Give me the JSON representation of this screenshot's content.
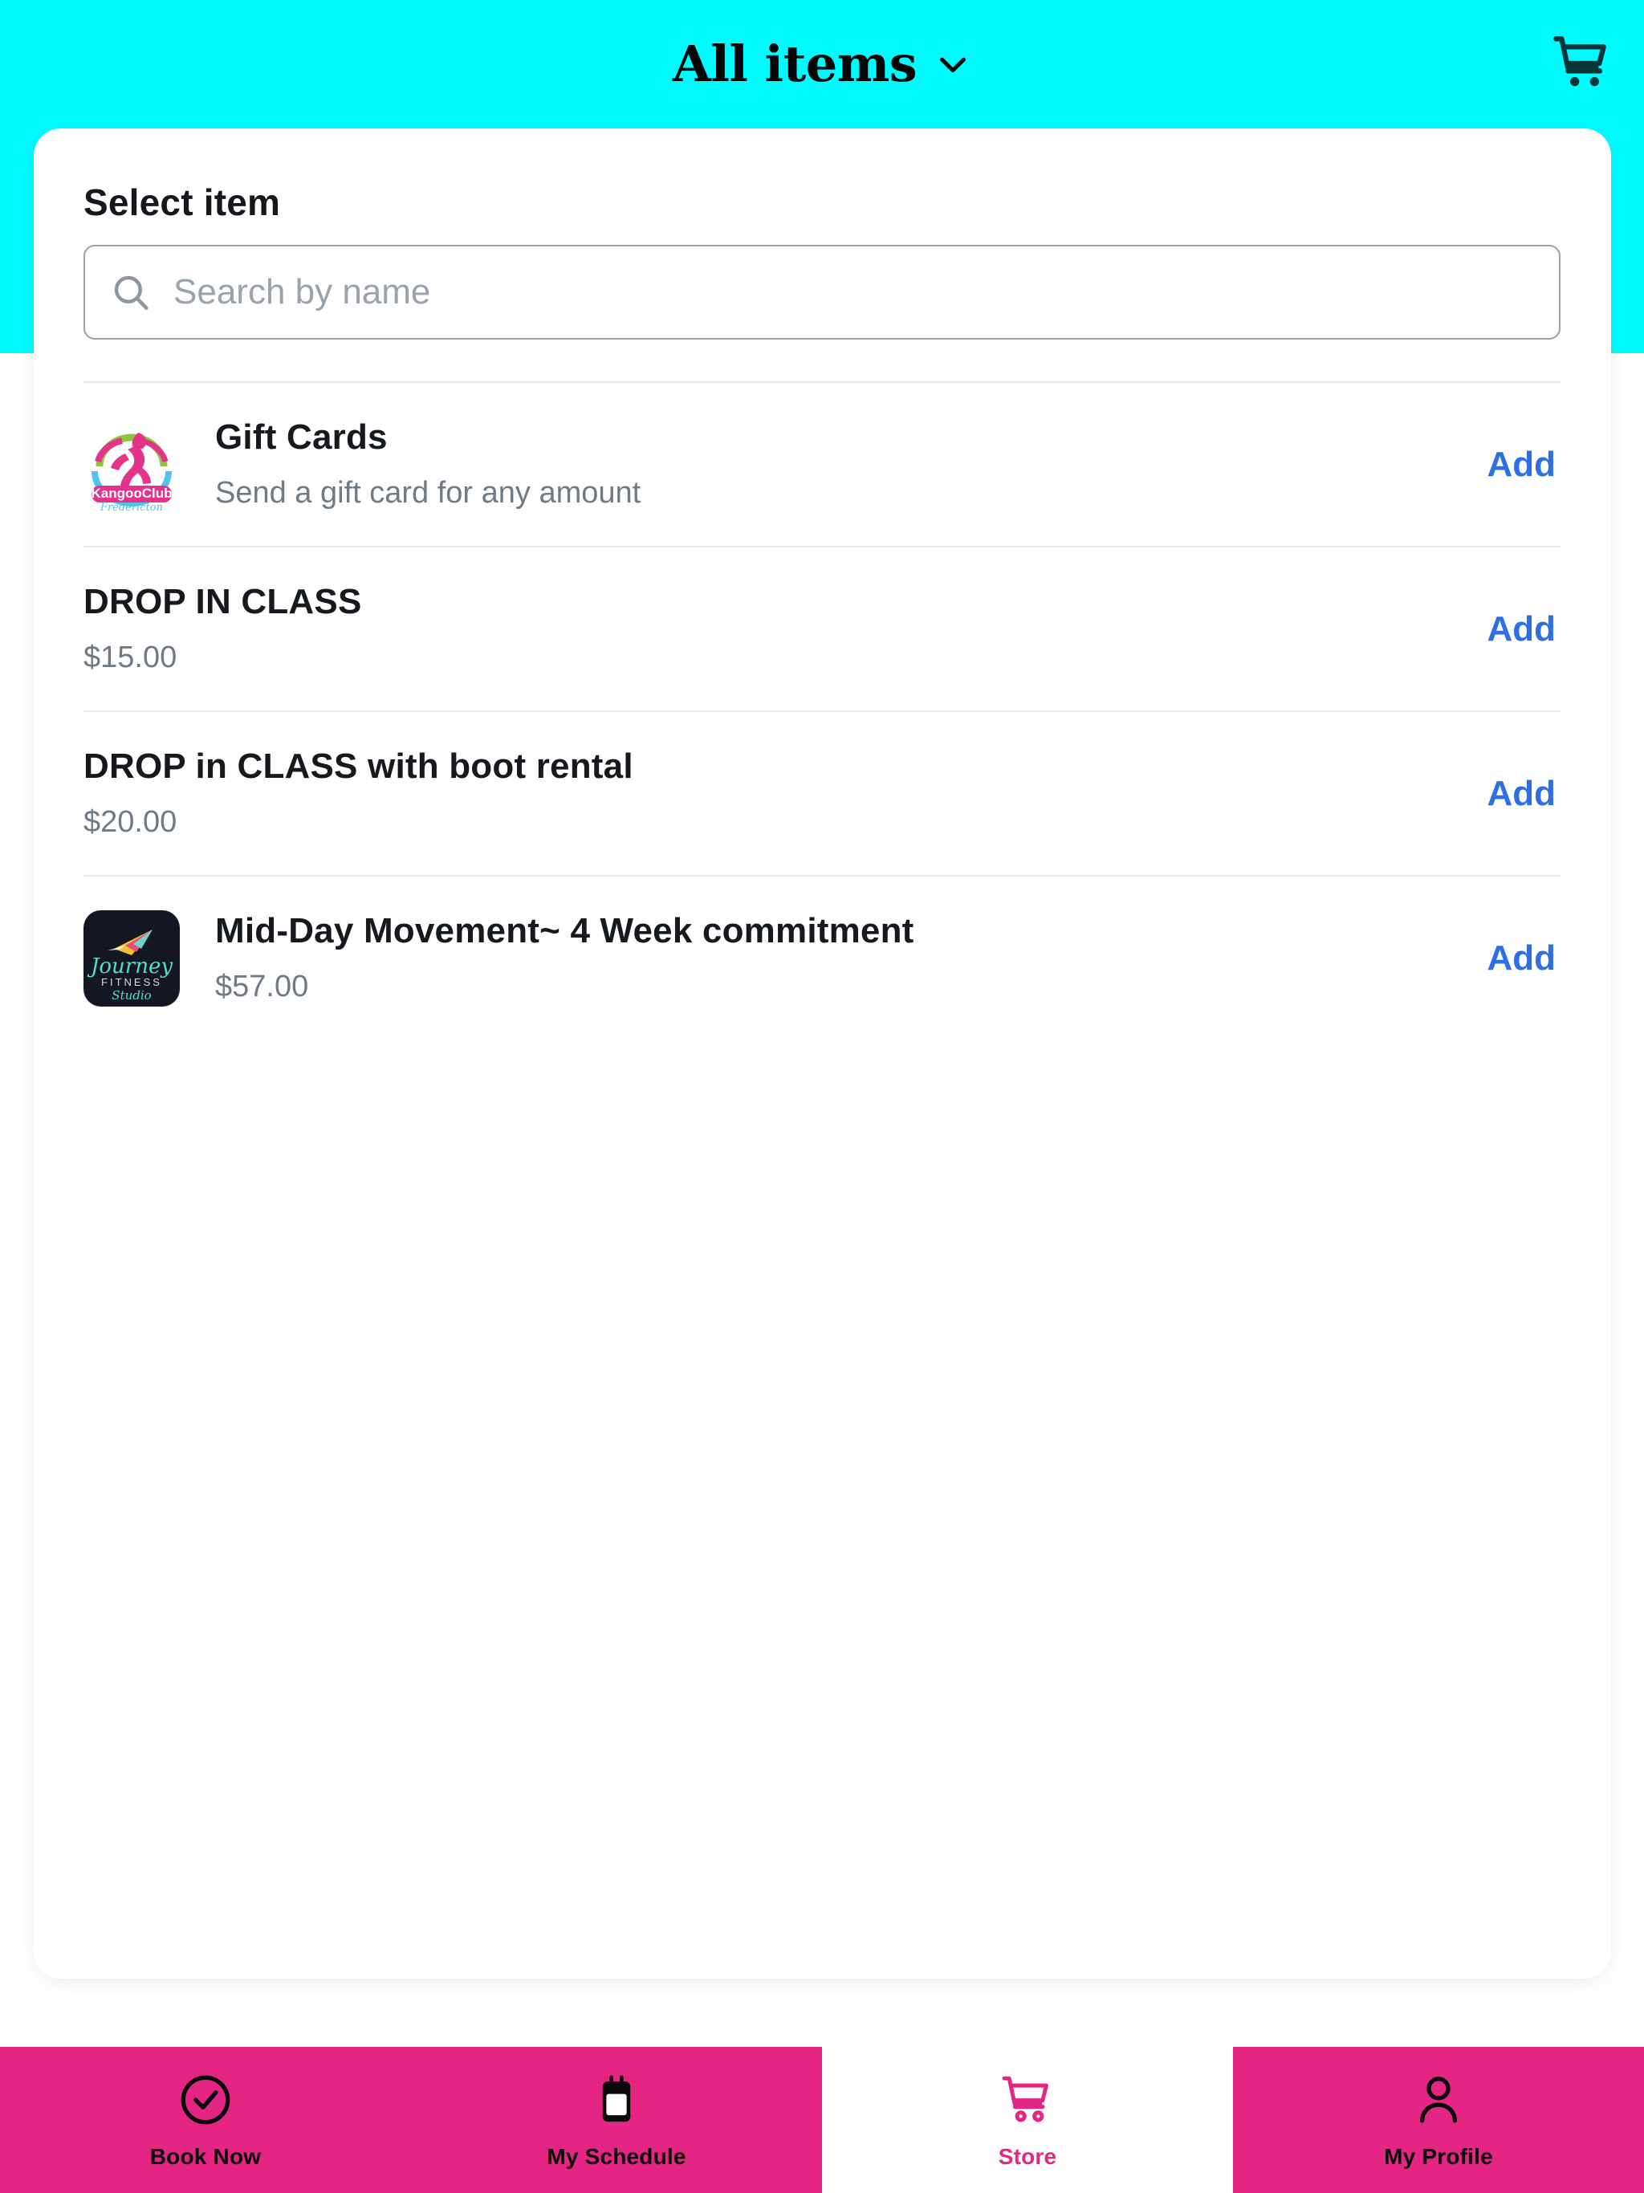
{
  "theme": {
    "header_bg": "#00fbff",
    "nav_bg": "#e42583",
    "accent_link": "#2f6fe4",
    "active_tab_bg": "#ffffff"
  },
  "header": {
    "title": "All items",
    "chevron_icon": "chevron-down-icon",
    "cart_icon": "shopping-cart-icon"
  },
  "card": {
    "title": "Select item"
  },
  "search": {
    "icon": "search-icon",
    "placeholder": "Search by name",
    "value": ""
  },
  "items": [
    {
      "name": "Gift Cards",
      "subtitle": "Send a gift card for any amount",
      "thumbnail": "kangooclub-fredericton-logo",
      "has_thumbnail": true,
      "action_label": "Add"
    },
    {
      "name": "DROP IN CLASS",
      "subtitle": "$15.00",
      "thumbnail": "",
      "has_thumbnail": false,
      "action_label": "Add"
    },
    {
      "name": "DROP in CLASS with boot rental",
      "subtitle": "$20.00",
      "thumbnail": "",
      "has_thumbnail": false,
      "action_label": "Add"
    },
    {
      "name": "Mid-Day Movement~ 4 Week commitment",
      "subtitle": "$57.00",
      "thumbnail": "journey-fitness-studio-logo",
      "has_thumbnail": true,
      "action_label": "Add"
    }
  ],
  "bottom_nav": {
    "tabs": [
      {
        "label": "Book Now",
        "icon": "check-circle-icon",
        "active": false
      },
      {
        "label": "My Schedule",
        "icon": "calendar-icon",
        "active": false
      },
      {
        "label": "Store",
        "icon": "shopping-cart-icon",
        "active": true
      },
      {
        "label": "My Profile",
        "icon": "person-icon",
        "active": false
      }
    ]
  }
}
